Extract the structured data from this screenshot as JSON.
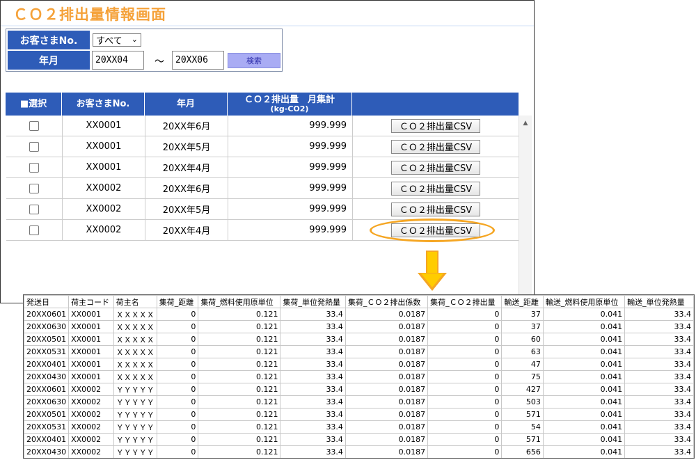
{
  "page": {
    "title": "ＣＯ２排出量情報画面"
  },
  "filter": {
    "customer_label": "お客さまNo.",
    "customer_value": "すべて",
    "month_label": "年月",
    "from": "20XX04",
    "tilde": "～",
    "to": "20XX06",
    "search_label": "検索"
  },
  "table": {
    "headers": {
      "select": "■選択",
      "customer": "お客さまNo.",
      "month": "年月",
      "co2_line1": "ＣＯ２排出量　月集計",
      "co2_line2": "(kg-CO2)"
    },
    "rows": [
      {
        "customer": "XX0001",
        "month": "20XX年6月",
        "value": "999.999",
        "button": "ＣＯ２排出量CSV"
      },
      {
        "customer": "XX0001",
        "month": "20XX年5月",
        "value": "999.999",
        "button": "ＣＯ２排出量CSV"
      },
      {
        "customer": "XX0001",
        "month": "20XX年4月",
        "value": "999.999",
        "button": "ＣＯ２排出量CSV"
      },
      {
        "customer": "XX0002",
        "month": "20XX年6月",
        "value": "999.999",
        "button": "ＣＯ２排出量CSV"
      },
      {
        "customer": "XX0002",
        "month": "20XX年5月",
        "value": "999.999",
        "button": "ＣＯ２排出量CSV"
      },
      {
        "customer": "XX0002",
        "month": "20XX年4月",
        "value": "999.999",
        "button": "ＣＯ２排出量CSV"
      }
    ]
  },
  "colors": {
    "header_blue": "#2e5cb8",
    "title_orange": "#f5a23a",
    "accent_yellow": "#ffcc00",
    "search_purple": "#a9acf4"
  },
  "icons": {
    "scroll_up": "triangle-up-icon",
    "dropdown": "chevron-down-icon",
    "arrow": "down-arrow-icon"
  },
  "csv": {
    "headers": [
      "発送日",
      "荷主コード",
      "荷主名",
      "集荷_距離",
      "集荷_燃料使用原単位",
      "集荷_単位発熱量",
      "集荷_ＣＯ２排出係数",
      "集荷_ＣＯ２排出量",
      "輸送_距離",
      "輸送_燃料使用原単位",
      "輸送_単位発熱量"
    ],
    "rows": [
      [
        "20XX0601",
        "XX0001",
        "ＸＸＸＸＸ",
        "0",
        "0.121",
        "33.4",
        "0.0187",
        "0",
        "37",
        "0.041",
        "33.4"
      ],
      [
        "20XX0630",
        "XX0001",
        "ＸＸＸＸＸ",
        "0",
        "0.121",
        "33.4",
        "0.0187",
        "0",
        "37",
        "0.041",
        "33.4"
      ],
      [
        "20XX0501",
        "XX0001",
        "ＸＸＸＸＸ",
        "0",
        "0.121",
        "33.4",
        "0.0187",
        "0",
        "60",
        "0.041",
        "33.4"
      ],
      [
        "20XX0531",
        "XX0001",
        "ＸＸＸＸＸ",
        "0",
        "0.121",
        "33.4",
        "0.0187",
        "0",
        "63",
        "0.041",
        "33.4"
      ],
      [
        "20XX0401",
        "XX0001",
        "ＸＸＸＸＸ",
        "0",
        "0.121",
        "33.4",
        "0.0187",
        "0",
        "47",
        "0.041",
        "33.4"
      ],
      [
        "20XX0430",
        "XX0001",
        "ＸＸＸＸＸ",
        "0",
        "0.121",
        "33.4",
        "0.0187",
        "0",
        "75",
        "0.041",
        "33.4"
      ],
      [
        "20XX0601",
        "XX0002",
        "ＹＹＹＹＹ",
        "0",
        "0.121",
        "33.4",
        "0.0187",
        "0",
        "427",
        "0.041",
        "33.4"
      ],
      [
        "20XX0630",
        "XX0002",
        "ＹＹＹＹＹ",
        "0",
        "0.121",
        "33.4",
        "0.0187",
        "0",
        "503",
        "0.041",
        "33.4"
      ],
      [
        "20XX0501",
        "XX0002",
        "ＹＹＹＹＹ",
        "0",
        "0.121",
        "33.4",
        "0.0187",
        "0",
        "571",
        "0.041",
        "33.4"
      ],
      [
        "20XX0531",
        "XX0002",
        "ＹＹＹＹＹ",
        "0",
        "0.121",
        "33.4",
        "0.0187",
        "0",
        "54",
        "0.041",
        "33.4"
      ],
      [
        "20XX0401",
        "XX0002",
        "ＹＹＹＹＹ",
        "0",
        "0.121",
        "33.4",
        "0.0187",
        "0",
        "571",
        "0.041",
        "33.4"
      ],
      [
        "20XX0430",
        "XX0002",
        "ＹＹＹＹＹ",
        "0",
        "0.121",
        "33.4",
        "0.0187",
        "0",
        "656",
        "0.041",
        "33.4"
      ]
    ]
  }
}
